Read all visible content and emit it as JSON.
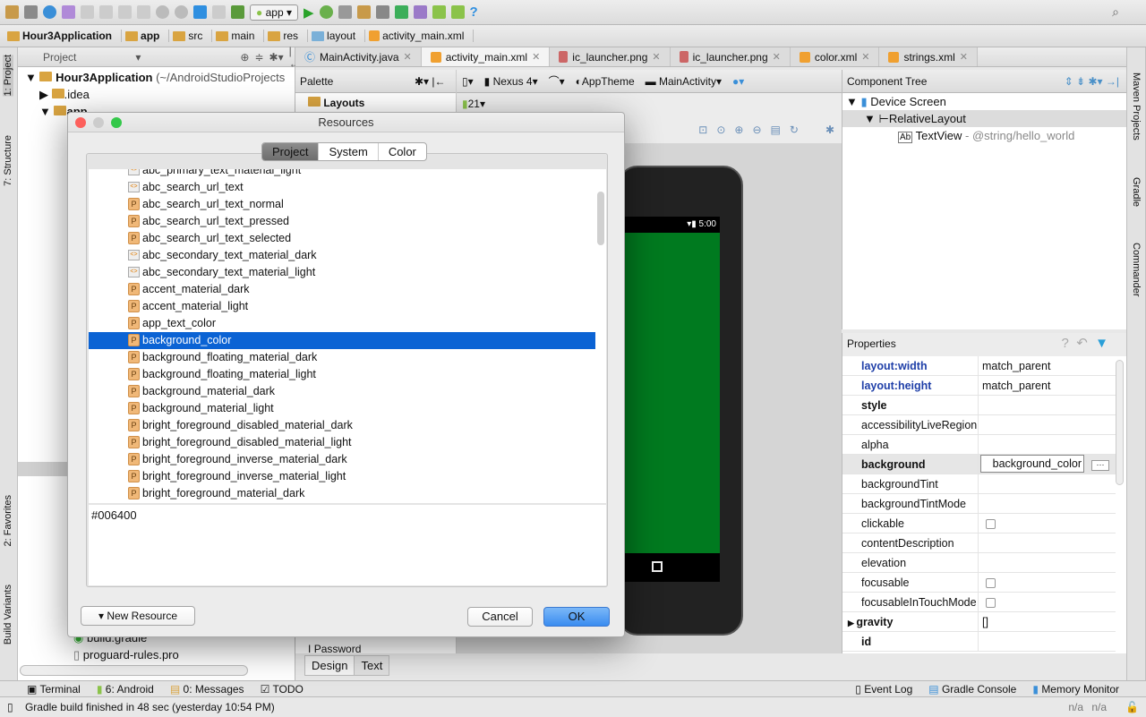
{
  "toolbar": {
    "run_config": "app"
  },
  "breadcrumb": [
    "Hour3Application",
    "app",
    "src",
    "main",
    "res",
    "layout",
    "activity_main.xml"
  ],
  "project_panel": {
    "view": "Project",
    "tree": [
      {
        "label": "Hour3Application",
        "suffix": "(~/AndroidStudioProjects"
      },
      {
        "label": ".idea"
      },
      {
        "label": "app"
      },
      {
        "label": "build.gradle"
      },
      {
        "label": "proguard-rules.pro"
      }
    ]
  },
  "left_strip": {
    "project": "1: Project",
    "structure": "7: Structure",
    "favorites": "2: Favorites",
    "build_variants": "Build Variants"
  },
  "right_strip": {
    "maven": "Maven Projects",
    "gradle": "Gradle",
    "commander": "Commander"
  },
  "editor_tabs": [
    {
      "label": "MainActivity.java",
      "active": false
    },
    {
      "label": "activity_main.xml",
      "active": true
    },
    {
      "label": "ic_launcher.png",
      "active": false
    },
    {
      "label": "ic_launcher.png",
      "active": false
    },
    {
      "label": "color.xml",
      "active": false
    },
    {
      "label": "strings.xml",
      "active": false
    }
  ],
  "palette": {
    "title": "Palette",
    "group": "Layouts",
    "bottom_item": "Password"
  },
  "designer": {
    "device": "Nexus 4",
    "theme": "AppTheme",
    "activity": "MainActivity",
    "api": "21",
    "phone_time": "5:00",
    "screen_color": "#007a1f",
    "tabs": [
      "Design",
      "Text"
    ]
  },
  "component_tree": {
    "title": "Component Tree",
    "items": [
      {
        "label": "Device Screen"
      },
      {
        "label": "RelativeLayout"
      },
      {
        "label": "TextView",
        "detail": "- @string/hello_world"
      }
    ]
  },
  "properties": {
    "title": "Properties",
    "rows": [
      {
        "key": "layout:width",
        "value": "match_parent",
        "style": "blue"
      },
      {
        "key": "layout:height",
        "value": "match_parent",
        "style": "blue"
      },
      {
        "key": "style",
        "value": "",
        "style": "bold"
      },
      {
        "key": "accessibilityLiveRegion",
        "value": ""
      },
      {
        "key": "alpha",
        "value": ""
      },
      {
        "key": "background",
        "value": "background_color",
        "style": "bold",
        "editing": true
      },
      {
        "key": "backgroundTint",
        "value": ""
      },
      {
        "key": "backgroundTintMode",
        "value": ""
      },
      {
        "key": "clickable",
        "value": "",
        "checkbox": true
      },
      {
        "key": "contentDescription",
        "value": ""
      },
      {
        "key": "elevation",
        "value": ""
      },
      {
        "key": "focusable",
        "value": "",
        "checkbox": true
      },
      {
        "key": "focusableInTouchMode",
        "value": "",
        "checkbox": true
      },
      {
        "key": "gravity",
        "value": "[]",
        "style": "bold"
      },
      {
        "key": "id",
        "value": "",
        "style": "bold"
      }
    ]
  },
  "dialog": {
    "title": "Resources",
    "tabs": [
      "Project",
      "System",
      "Color"
    ],
    "active_tab": "Project",
    "items": [
      {
        "label": "abc_primary_text_material_light",
        "icon": "xml"
      },
      {
        "label": "abc_search_url_text",
        "icon": "xml"
      },
      {
        "label": "abc_search_url_text_normal",
        "icon": "p"
      },
      {
        "label": "abc_search_url_text_pressed",
        "icon": "p"
      },
      {
        "label": "abc_search_url_text_selected",
        "icon": "p"
      },
      {
        "label": "abc_secondary_text_material_dark",
        "icon": "xml"
      },
      {
        "label": "abc_secondary_text_material_light",
        "icon": "xml"
      },
      {
        "label": "accent_material_dark",
        "icon": "p"
      },
      {
        "label": "accent_material_light",
        "icon": "p"
      },
      {
        "label": "app_text_color",
        "icon": "p"
      },
      {
        "label": "background_color",
        "icon": "p",
        "selected": true
      },
      {
        "label": "background_floating_material_dark",
        "icon": "p"
      },
      {
        "label": "background_floating_material_light",
        "icon": "p"
      },
      {
        "label": "background_material_dark",
        "icon": "p"
      },
      {
        "label": "background_material_light",
        "icon": "p"
      },
      {
        "label": "bright_foreground_disabled_material_dark",
        "icon": "p"
      },
      {
        "label": "bright_foreground_disabled_material_light",
        "icon": "p"
      },
      {
        "label": "bright_foreground_inverse_material_dark",
        "icon": "p"
      },
      {
        "label": "bright_foreground_inverse_material_light",
        "icon": "p"
      },
      {
        "label": "bright_foreground_material_dark",
        "icon": "p"
      }
    ],
    "preview_value": "#006400",
    "new_resource": "New Resource",
    "cancel": "Cancel",
    "ok": "OK"
  },
  "tool_windows": {
    "left": [
      "Terminal",
      "6: Android",
      "0: Messages",
      "TODO"
    ],
    "right": [
      "Event Log",
      "Gradle Console",
      "Memory Monitor"
    ]
  },
  "status": {
    "message": "Gradle build finished in 48 sec (yesterday 10:54 PM)",
    "pos1": "n/a",
    "pos2": "n/a"
  }
}
